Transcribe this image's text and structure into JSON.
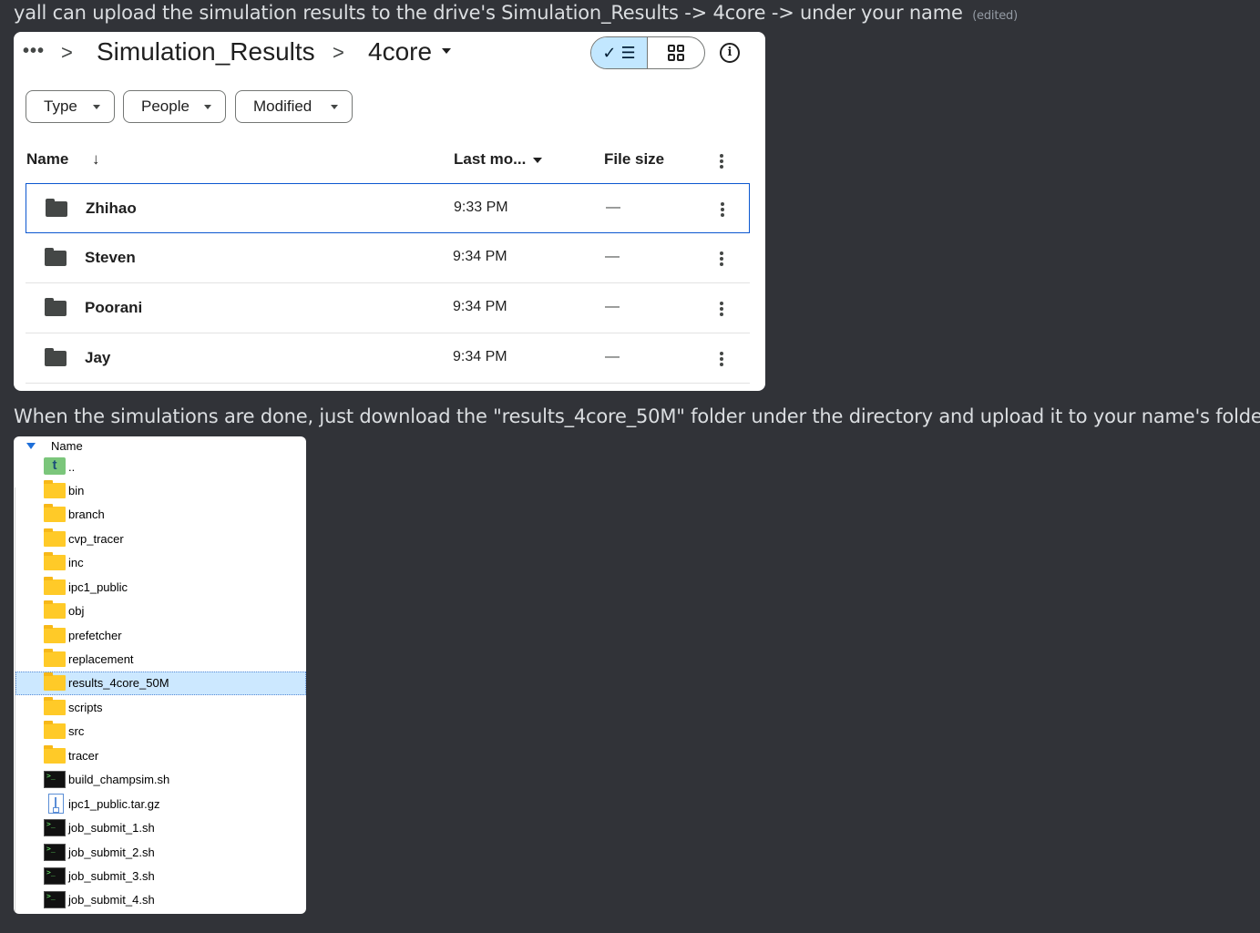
{
  "messages": {
    "first": "yall can upload the simulation results to the drive's Simulation_Results -> 4core -> under your name",
    "edited": "(edited)",
    "second": "When the simulations are done, just download the \"results_4core_50M\" folder under the directory and upload it to your name's folder"
  },
  "drive": {
    "breadcrumb": {
      "overflow": "•••",
      "separator": ">",
      "parent": "Simulation_Results",
      "current": "4core"
    },
    "filters": {
      "type": "Type",
      "people": "People",
      "modified": "Modified"
    },
    "columns": {
      "name": "Name",
      "sort_arrow": "↓",
      "last_modified": "Last mo...",
      "file_size": "File size"
    },
    "rows": [
      {
        "name": "Zhihao",
        "time": "9:33 PM",
        "size": "—",
        "selected": true
      },
      {
        "name": "Steven",
        "time": "9:34 PM",
        "size": "—"
      },
      {
        "name": "Poorani",
        "time": "9:34 PM",
        "size": "—"
      },
      {
        "name": "Jay",
        "time": "9:34 PM",
        "size": "—"
      }
    ],
    "colors": {
      "selected_border": "#0b57d0",
      "toggle_active": "#c2e7ff"
    }
  },
  "explorer": {
    "header": "Name",
    "items": [
      {
        "label": "..",
        "icon": "parent-dir-icon"
      },
      {
        "label": "bin",
        "icon": "folder-icon"
      },
      {
        "label": "branch",
        "icon": "folder-icon"
      },
      {
        "label": "cvp_tracer",
        "icon": "folder-icon"
      },
      {
        "label": "inc",
        "icon": "folder-icon"
      },
      {
        "label": "ipc1_public",
        "icon": "folder-icon"
      },
      {
        "label": "obj",
        "icon": "folder-icon"
      },
      {
        "label": "prefetcher",
        "icon": "folder-icon"
      },
      {
        "label": "replacement",
        "icon": "folder-icon"
      },
      {
        "label": "results_4core_50M",
        "icon": "folder-icon",
        "selected": true
      },
      {
        "label": "scripts",
        "icon": "folder-icon"
      },
      {
        "label": "src",
        "icon": "folder-icon"
      },
      {
        "label": "tracer",
        "icon": "folder-icon"
      },
      {
        "label": "build_champsim.sh",
        "icon": "shell-script-icon"
      },
      {
        "label": "ipc1_public.tar.gz",
        "icon": "archive-icon"
      },
      {
        "label": "job_submit_1.sh",
        "icon": "shell-script-icon"
      },
      {
        "label": "job_submit_2.sh",
        "icon": "shell-script-icon"
      },
      {
        "label": "job_submit_3.sh",
        "icon": "shell-script-icon"
      },
      {
        "label": "job_submit_4.sh",
        "icon": "shell-script-icon"
      }
    ],
    "colors": {
      "folder": "#ffca28",
      "selected_row": "#cce8ff"
    }
  }
}
